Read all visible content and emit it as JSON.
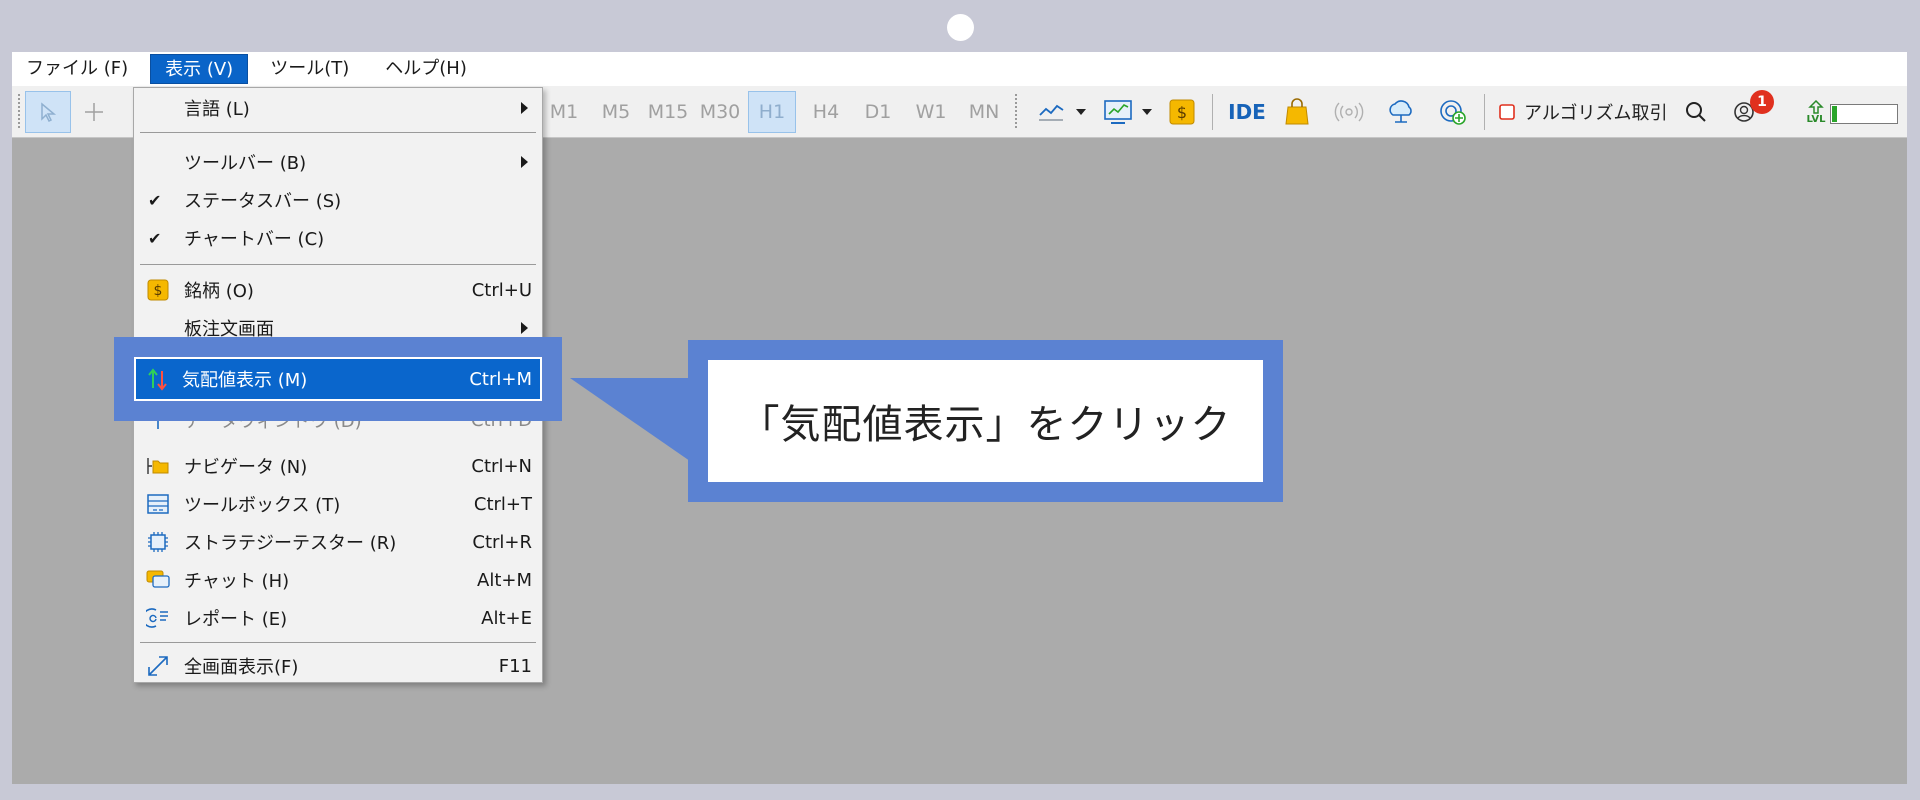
{
  "menubar": {
    "items": [
      {
        "label": "ファイル (F)"
      },
      {
        "label": "表示 (V)"
      },
      {
        "label": "ツール(T)"
      },
      {
        "label": "ヘルプ(H)"
      }
    ]
  },
  "toolbar": {
    "timeframes": [
      "M1",
      "M5",
      "M15",
      "M30",
      "H1",
      "H4",
      "D1",
      "W1",
      "MN"
    ],
    "selected_timeframe": "H1",
    "ide_label": "IDE",
    "algo_label": "アルゴリズム取引",
    "notification_count": "1",
    "level_label": "LVL",
    "level_progress": 0.08
  },
  "view_menu": {
    "items": [
      {
        "label": "言語 (L)",
        "submenu": true
      },
      {
        "label": "ツールバー (B)",
        "submenu": true
      },
      {
        "label": "ステータスバー (S)",
        "checked": true
      },
      {
        "label": "チャートバー (C)",
        "checked": true
      },
      {
        "label": "銘柄 (O)",
        "shortcut": "Ctrl+U",
        "icon": "dollar-icon"
      },
      {
        "label": "板注文画面",
        "submenu": true
      },
      {
        "label": "データウィンドウ (D)",
        "shortcut": "Ctrl+D",
        "icon": "crosshair-icon"
      },
      {
        "label": "ナビゲータ (N)",
        "shortcut": "Ctrl+N",
        "icon": "folder-tree-icon"
      },
      {
        "label": "ツールボックス (T)",
        "shortcut": "Ctrl+T",
        "icon": "toolbox-icon"
      },
      {
        "label": "ストラテジーテスター (R)",
        "shortcut": "Ctrl+R",
        "icon": "chip-icon"
      },
      {
        "label": "チャット (H)",
        "shortcut": "Alt+M",
        "icon": "chat-icon"
      },
      {
        "label": "レポート (E)",
        "shortcut": "Alt+E",
        "icon": "report-icon"
      },
      {
        "label": "全画面表示(F)",
        "shortcut": "F11",
        "icon": "fullscreen-icon"
      }
    ],
    "highlighted": {
      "label": "気配値表示 (M)",
      "shortcut": "Ctrl+M",
      "icon": "market-watch-icon"
    }
  },
  "callout": {
    "text": "「気配値表示」をクリック"
  },
  "colors": {
    "accent": "#0a66cc",
    "callout_frame": "#5b82d2",
    "background": "#ababab"
  }
}
